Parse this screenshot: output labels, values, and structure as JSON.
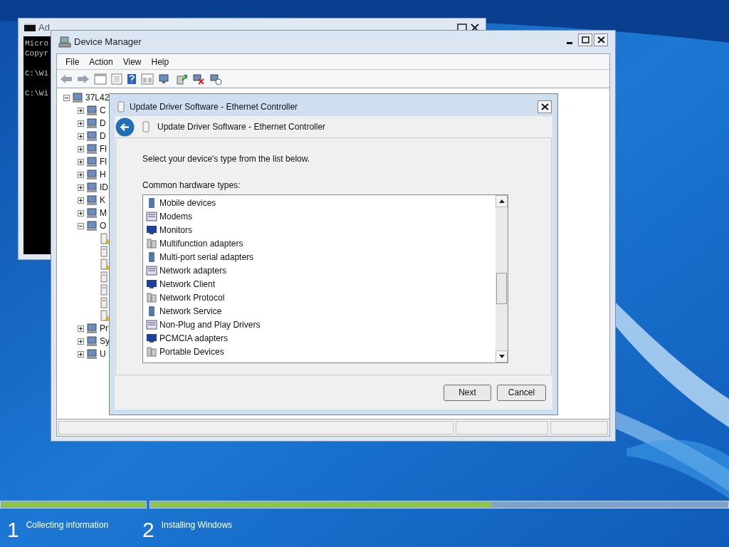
{
  "console_window": {
    "title": "Ad",
    "lines": [
      "Micro",
      "Copyr",
      "C:\\Wi",
      "C:\\Wi"
    ]
  },
  "device_manager": {
    "title": "Device Manager",
    "menu": [
      "File",
      "Action",
      "View",
      "Help"
    ],
    "tree": [
      {
        "label": "37L42",
        "expanded": true,
        "children": [
          {
            "label": "C",
            "expanded": false
          },
          {
            "label": "D",
            "expanded": false
          },
          {
            "label": "D",
            "expanded": false
          },
          {
            "label": "Fl",
            "expanded": false
          },
          {
            "label": "Fl",
            "expanded": false
          },
          {
            "label": "H",
            "expanded": false
          },
          {
            "label": "ID",
            "expanded": false
          },
          {
            "label": "K",
            "expanded": false
          },
          {
            "label": "M",
            "expanded": false
          },
          {
            "label": "O",
            "expanded": true,
            "children": [
              {
                "warning": true
              },
              {
                "warning": false
              },
              {
                "warning": true
              },
              {
                "warning": false
              },
              {
                "warning": false
              },
              {
                "warning": false
              },
              {
                "warning": true
              }
            ]
          },
          {
            "label": "Pr",
            "expanded": false
          },
          {
            "label": "Sy",
            "expanded": false
          },
          {
            "label": "U",
            "expanded": false
          }
        ]
      }
    ]
  },
  "dialog": {
    "title": "Update Driver Software - Ethernet Controller",
    "heading": "Update Driver Software - Ethernet Controller",
    "instruction": "Select your device's type from the list below.",
    "list_label": "Common hardware types:",
    "hardware_types": [
      "Mobile devices",
      "Modems",
      "Monitors",
      "Multifunction adapters",
      "Multi-port serial adapters",
      "Network adapters",
      "Network Client",
      "Network Protocol",
      "Network Service",
      "Non-Plug and Play Drivers",
      "PCMCIA adapters",
      "Portable Devices"
    ],
    "buttons": [
      "Next",
      "Cancel"
    ]
  },
  "setup_progress": {
    "segments": [
      {
        "level": 1
      },
      {
        "level": 0.59
      }
    ],
    "steps": [
      {
        "number": "1",
        "label": "Collecting information"
      },
      {
        "number": "2",
        "label": "Installing Windows"
      }
    ]
  }
}
